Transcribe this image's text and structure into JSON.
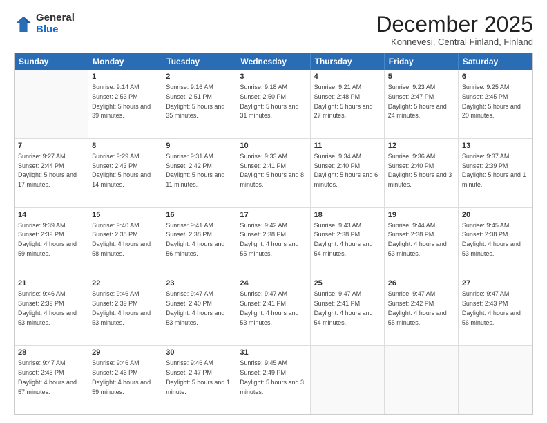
{
  "logo": {
    "general": "General",
    "blue": "Blue"
  },
  "header": {
    "title": "December 2025",
    "subtitle": "Konnevesi, Central Finland, Finland"
  },
  "days": [
    "Sunday",
    "Monday",
    "Tuesday",
    "Wednesday",
    "Thursday",
    "Friday",
    "Saturday"
  ],
  "weeks": [
    [
      {
        "day": "",
        "empty": true
      },
      {
        "day": "1",
        "sunrise": "Sunrise: 9:14 AM",
        "sunset": "Sunset: 2:53 PM",
        "daylight": "Daylight: 5 hours and 39 minutes."
      },
      {
        "day": "2",
        "sunrise": "Sunrise: 9:16 AM",
        "sunset": "Sunset: 2:51 PM",
        "daylight": "Daylight: 5 hours and 35 minutes."
      },
      {
        "day": "3",
        "sunrise": "Sunrise: 9:18 AM",
        "sunset": "Sunset: 2:50 PM",
        "daylight": "Daylight: 5 hours and 31 minutes."
      },
      {
        "day": "4",
        "sunrise": "Sunrise: 9:21 AM",
        "sunset": "Sunset: 2:48 PM",
        "daylight": "Daylight: 5 hours and 27 minutes."
      },
      {
        "day": "5",
        "sunrise": "Sunrise: 9:23 AM",
        "sunset": "Sunset: 2:47 PM",
        "daylight": "Daylight: 5 hours and 24 minutes."
      },
      {
        "day": "6",
        "sunrise": "Sunrise: 9:25 AM",
        "sunset": "Sunset: 2:45 PM",
        "daylight": "Daylight: 5 hours and 20 minutes."
      }
    ],
    [
      {
        "day": "7",
        "sunrise": "Sunrise: 9:27 AM",
        "sunset": "Sunset: 2:44 PM",
        "daylight": "Daylight: 5 hours and 17 minutes."
      },
      {
        "day": "8",
        "sunrise": "Sunrise: 9:29 AM",
        "sunset": "Sunset: 2:43 PM",
        "daylight": "Daylight: 5 hours and 14 minutes."
      },
      {
        "day": "9",
        "sunrise": "Sunrise: 9:31 AM",
        "sunset": "Sunset: 2:42 PM",
        "daylight": "Daylight: 5 hours and 11 minutes."
      },
      {
        "day": "10",
        "sunrise": "Sunrise: 9:33 AM",
        "sunset": "Sunset: 2:41 PM",
        "daylight": "Daylight: 5 hours and 8 minutes."
      },
      {
        "day": "11",
        "sunrise": "Sunrise: 9:34 AM",
        "sunset": "Sunset: 2:40 PM",
        "daylight": "Daylight: 5 hours and 6 minutes."
      },
      {
        "day": "12",
        "sunrise": "Sunrise: 9:36 AM",
        "sunset": "Sunset: 2:40 PM",
        "daylight": "Daylight: 5 hours and 3 minutes."
      },
      {
        "day": "13",
        "sunrise": "Sunrise: 9:37 AM",
        "sunset": "Sunset: 2:39 PM",
        "daylight": "Daylight: 5 hours and 1 minute."
      }
    ],
    [
      {
        "day": "14",
        "sunrise": "Sunrise: 9:39 AM",
        "sunset": "Sunset: 2:39 PM",
        "daylight": "Daylight: 4 hours and 59 minutes."
      },
      {
        "day": "15",
        "sunrise": "Sunrise: 9:40 AM",
        "sunset": "Sunset: 2:38 PM",
        "daylight": "Daylight: 4 hours and 58 minutes."
      },
      {
        "day": "16",
        "sunrise": "Sunrise: 9:41 AM",
        "sunset": "Sunset: 2:38 PM",
        "daylight": "Daylight: 4 hours and 56 minutes."
      },
      {
        "day": "17",
        "sunrise": "Sunrise: 9:42 AM",
        "sunset": "Sunset: 2:38 PM",
        "daylight": "Daylight: 4 hours and 55 minutes."
      },
      {
        "day": "18",
        "sunrise": "Sunrise: 9:43 AM",
        "sunset": "Sunset: 2:38 PM",
        "daylight": "Daylight: 4 hours and 54 minutes."
      },
      {
        "day": "19",
        "sunrise": "Sunrise: 9:44 AM",
        "sunset": "Sunset: 2:38 PM",
        "daylight": "Daylight: 4 hours and 53 minutes."
      },
      {
        "day": "20",
        "sunrise": "Sunrise: 9:45 AM",
        "sunset": "Sunset: 2:38 PM",
        "daylight": "Daylight: 4 hours and 53 minutes."
      }
    ],
    [
      {
        "day": "21",
        "sunrise": "Sunrise: 9:46 AM",
        "sunset": "Sunset: 2:39 PM",
        "daylight": "Daylight: 4 hours and 53 minutes."
      },
      {
        "day": "22",
        "sunrise": "Sunrise: 9:46 AM",
        "sunset": "Sunset: 2:39 PM",
        "daylight": "Daylight: 4 hours and 53 minutes."
      },
      {
        "day": "23",
        "sunrise": "Sunrise: 9:47 AM",
        "sunset": "Sunset: 2:40 PM",
        "daylight": "Daylight: 4 hours and 53 minutes."
      },
      {
        "day": "24",
        "sunrise": "Sunrise: 9:47 AM",
        "sunset": "Sunset: 2:41 PM",
        "daylight": "Daylight: 4 hours and 53 minutes."
      },
      {
        "day": "25",
        "sunrise": "Sunrise: 9:47 AM",
        "sunset": "Sunset: 2:41 PM",
        "daylight": "Daylight: 4 hours and 54 minutes."
      },
      {
        "day": "26",
        "sunrise": "Sunrise: 9:47 AM",
        "sunset": "Sunset: 2:42 PM",
        "daylight": "Daylight: 4 hours and 55 minutes."
      },
      {
        "day": "27",
        "sunrise": "Sunrise: 9:47 AM",
        "sunset": "Sunset: 2:43 PM",
        "daylight": "Daylight: 4 hours and 56 minutes."
      }
    ],
    [
      {
        "day": "28",
        "sunrise": "Sunrise: 9:47 AM",
        "sunset": "Sunset: 2:45 PM",
        "daylight": "Daylight: 4 hours and 57 minutes."
      },
      {
        "day": "29",
        "sunrise": "Sunrise: 9:46 AM",
        "sunset": "Sunset: 2:46 PM",
        "daylight": "Daylight: 4 hours and 59 minutes."
      },
      {
        "day": "30",
        "sunrise": "Sunrise: 9:46 AM",
        "sunset": "Sunset: 2:47 PM",
        "daylight": "Daylight: 5 hours and 1 minute."
      },
      {
        "day": "31",
        "sunrise": "Sunrise: 9:45 AM",
        "sunset": "Sunset: 2:49 PM",
        "daylight": "Daylight: 5 hours and 3 minutes."
      },
      {
        "day": "",
        "empty": true
      },
      {
        "day": "",
        "empty": true
      },
      {
        "day": "",
        "empty": true
      }
    ]
  ]
}
